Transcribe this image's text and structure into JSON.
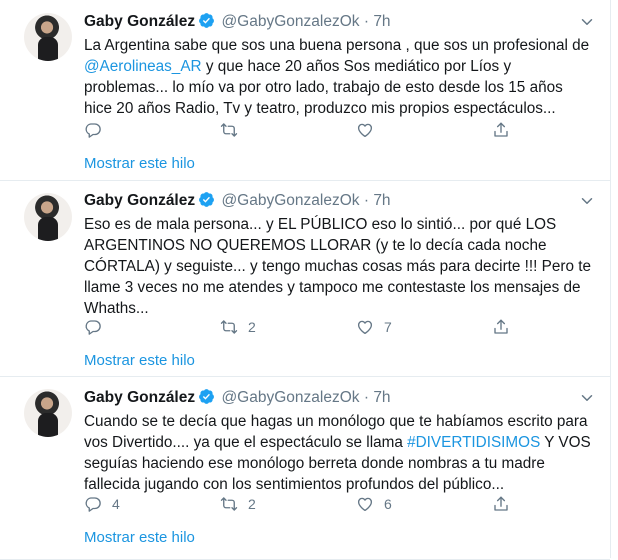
{
  "tweets": [
    {
      "name": "Gaby González",
      "handle": "@GabyGonzalezOk",
      "dot": "·",
      "time": "7h",
      "text_parts": [
        "La Argentina sabe que sos una buena persona , que sos un profesional de ",
        "@Aerolineas_AR",
        " y que hace 20 años Sos mediático por Líos y problemas... lo mío va por otro lado, trabajo de esto desde los 15 años hice 20 años Radio, Tv y teatro, produzco mis propios espectáculos..."
      ],
      "reply_count": "",
      "retweet_count": "",
      "like_count": "",
      "show_thread": "Mostrar este hilo"
    },
    {
      "name": "Gaby González",
      "handle": "@GabyGonzalezOk",
      "dot": "·",
      "time": "7h",
      "text": "Eso es de mala persona... y EL PÚBLICO eso lo sintió... por qué LOS ARGENTINOS NO QUEREMOS LLORAR (y te lo decía cada noche CÓRTALA) y seguiste... y tengo muchas cosas más para decirte !!! Pero te llame 3 veces no me atendes y tampoco me contestaste los mensajes de Whaths...",
      "reply_count": "",
      "retweet_count": "2",
      "like_count": "7",
      "show_thread": "Mostrar este hilo"
    },
    {
      "name": "Gaby González",
      "handle": "@GabyGonzalezOk",
      "dot": "·",
      "time": "7h",
      "text_parts": [
        "Cuando se te decía que hagas un monólogo que te habíamos escrito para vos Divertido.... ya que el espectáculo se llama ",
        "#DIVERTIDISIMOS",
        " Y VOS seguías haciendo ese monólogo berreta donde nombras a tu madre fallecida jugando con los sentimientos profundos del público..."
      ],
      "reply_count": "4",
      "retweet_count": "2",
      "like_count": "6",
      "show_thread": "Mostrar este hilo"
    }
  ],
  "icons": {
    "verified": "verified-badge-icon",
    "caret": "chevron-down-icon",
    "reply": "reply-icon",
    "retweet": "retweet-icon",
    "like": "heart-icon",
    "share": "share-icon"
  },
  "colors": {
    "link": "#1b95e0",
    "secondary_text": "#657786",
    "border": "#e6ecf0"
  }
}
